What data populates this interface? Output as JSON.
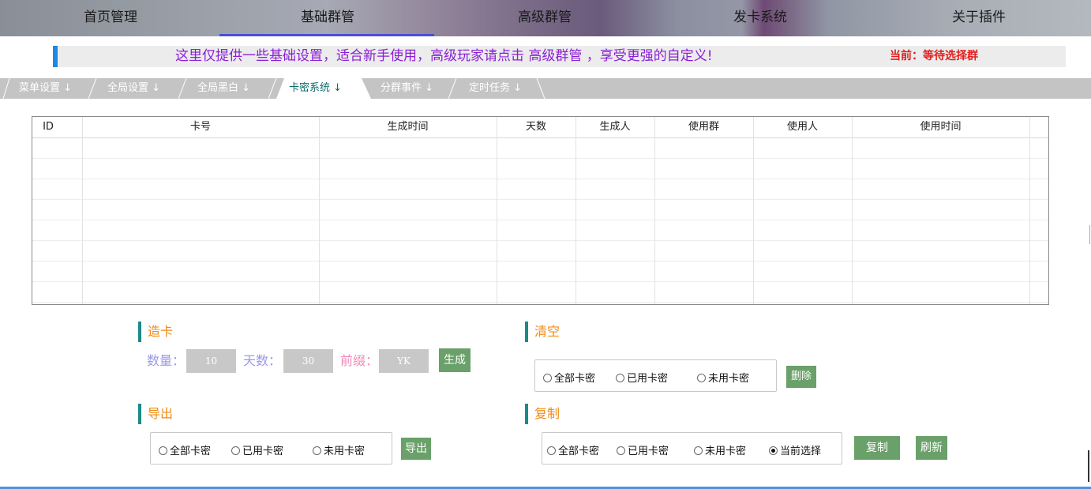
{
  "nav": {
    "items": [
      "首页管理",
      "基础群管",
      "高级群管",
      "发卡系统",
      "关于插件"
    ],
    "active": "基础群管"
  },
  "notice": {
    "message": "这里仅提供一些基础设置，适合新手使用，高级玩家请点击 高级群管 ，享受更强的自定义!",
    "current": "当前：等待选择群"
  },
  "tabs": [
    {
      "label": "菜单设置 ↓",
      "active": false
    },
    {
      "label": "全局设置 ↓",
      "active": false
    },
    {
      "label": "全局黑白 ↓",
      "active": false
    },
    {
      "label": "卡密系统 ↓",
      "active": true
    },
    {
      "label": "分群事件 ↓",
      "active": false
    },
    {
      "label": "定时任务 ↓",
      "active": false
    }
  ],
  "table": {
    "headers": [
      "ID",
      "卡号",
      "生成时间",
      "天数",
      "生成人",
      "使用群",
      "使用人",
      "使用时间"
    ],
    "rows": []
  },
  "make_card": {
    "title": "造卡",
    "count_label": "数量：",
    "count_value": "10",
    "days_label": "天数：",
    "days_value": "30",
    "prefix_label": "前缀：",
    "prefix_value": "YK",
    "generate_label": "生成"
  },
  "clear": {
    "title": "清空",
    "options": [
      "全部卡密",
      "已用卡密",
      "未用卡密"
    ],
    "delete_label": "删除"
  },
  "export": {
    "title": "导出",
    "options": [
      "全部卡密",
      "已用卡密",
      "未用卡密"
    ],
    "export_label": "导出"
  },
  "copy": {
    "title": "复制",
    "options": [
      "全部卡密",
      "已用卡密",
      "未用卡密",
      "当前选择"
    ],
    "selected": "当前选择",
    "copy_label": "复制",
    "refresh_label": "刷新"
  },
  "colors": {
    "accent_green": "#6aa06a",
    "section_title": "#f08a14",
    "notice_text": "#8b1fd6",
    "current_text": "#e02020"
  }
}
